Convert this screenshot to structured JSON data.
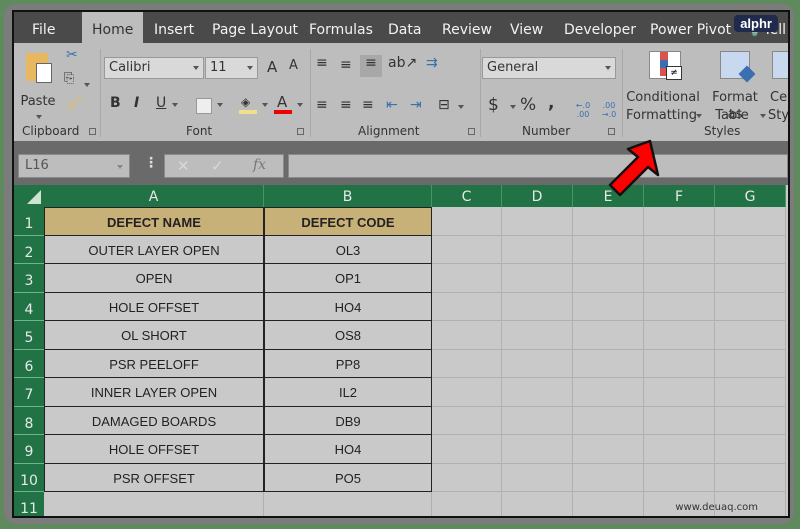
{
  "badge": "alphr",
  "watermark": "www.deuaq.com",
  "tabs": [
    {
      "label": "File"
    },
    {
      "label": "Home",
      "active": true
    },
    {
      "label": "Insert"
    },
    {
      "label": "Page Layout"
    },
    {
      "label": "Formulas"
    },
    {
      "label": "Data"
    },
    {
      "label": "Review"
    },
    {
      "label": "View"
    },
    {
      "label": "Developer"
    },
    {
      "label": "Power Pivot"
    },
    {
      "label": "Tell"
    }
  ],
  "ribbon": {
    "clipboard": {
      "label": "Clipboard",
      "paste": "Paste"
    },
    "font": {
      "label": "Font",
      "name": "Calibri",
      "size": "11",
      "bold": "B",
      "italic": "I",
      "underline": "U",
      "grow": "A",
      "shrink": "A",
      "font_color": "A"
    },
    "alignment": {
      "label": "Alignment"
    },
    "number": {
      "label": "Number",
      "format": "General",
      "currency": "$",
      "percent": "%",
      "comma": ",",
      "inc_decimal": "←.0 .00",
      "dec_decimal": ".00 →.0"
    },
    "styles": {
      "label": "Styles",
      "conditional_formatting_1": "Conditional",
      "conditional_formatting_2": "Formatting",
      "format_as_table_1": "Format as",
      "format_as_table_2": "Table",
      "cell_styles_1": "Ce",
      "cell_styles_2": "Styl"
    }
  },
  "formula_bar": {
    "name_box": "L16",
    "cancel": "✕",
    "enter": "✓",
    "fx": "fx",
    "value": ""
  },
  "sheet": {
    "columns": [
      "A",
      "B",
      "C",
      "D",
      "E",
      "F",
      "G"
    ],
    "rows": [
      "1",
      "2",
      "3",
      "4",
      "5",
      "6",
      "7",
      "8",
      "9",
      "10",
      "11"
    ],
    "header": [
      "DEFECT NAME",
      "DEFECT CODE"
    ],
    "data": [
      [
        "OUTER LAYER OPEN",
        "OL3"
      ],
      [
        "OPEN",
        "OP1"
      ],
      [
        "HOLE OFFSET",
        "HO4"
      ],
      [
        "OL SHORT",
        "OS8"
      ],
      [
        "PSR PEELOFF",
        "PP8"
      ],
      [
        "INNER LAYER OPEN",
        "IL2"
      ],
      [
        "DAMAGED BOARDS",
        "DB9"
      ],
      [
        "HOLE OFFSET",
        "HO4"
      ],
      [
        "PSR OFFSET",
        "PO5"
      ]
    ]
  },
  "colors": {
    "excel_green": "#217346",
    "header_fill": "#c8b079",
    "arrow": "#ff0000"
  }
}
